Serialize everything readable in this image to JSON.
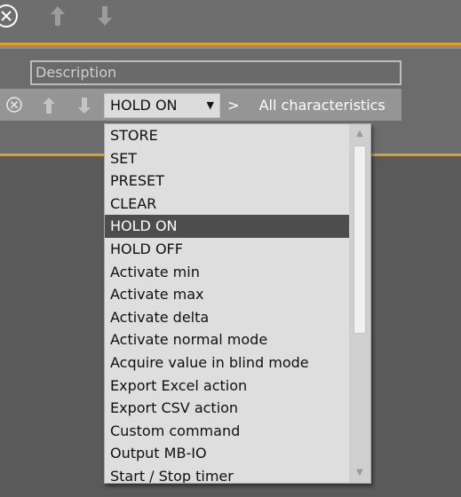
{
  "toolbar_top": {
    "icons": [
      "close-circle-icon",
      "arrow-up-icon",
      "arrow-down-icon"
    ]
  },
  "panel": {
    "description_placeholder": "Description",
    "row_icons": [
      "close-circle-icon",
      "arrow-up-icon",
      "arrow-down-icon"
    ],
    "selected_action": "HOLD ON",
    "breadcrumb_separator": ">",
    "breadcrumb_text": "All characteristics"
  },
  "dropdown": {
    "items": [
      "STORE",
      "SET",
      "PRESET",
      "CLEAR",
      "HOLD ON",
      "HOLD OFF",
      "Activate min",
      "Activate max",
      "Activate delta",
      "Activate normal mode",
      "Acquire value in blind mode",
      "Export Excel action",
      "Export CSV action",
      "Custom command",
      "Output MB-IO",
      "Start / Stop timer"
    ],
    "selected_index": 4
  },
  "colors": {
    "accent": "#e0a020",
    "selected_bg": "#4d4d4d",
    "list_bg": "#dedede"
  }
}
